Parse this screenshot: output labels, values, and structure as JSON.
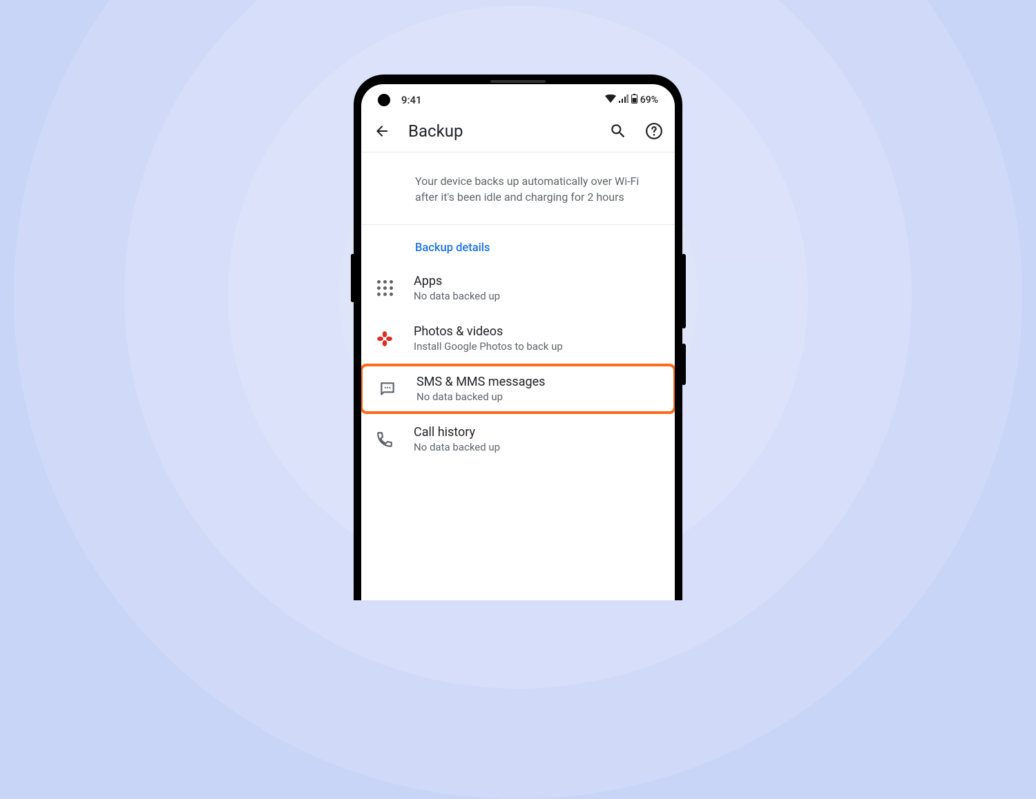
{
  "status": {
    "time": "9:41",
    "battery": "69%"
  },
  "appbar": {
    "title": "Backup"
  },
  "info": "Your device backs up automatically over Wi-Fi after it's been idle and charging for 2 hours",
  "section": {
    "header": "Backup details"
  },
  "items": [
    {
      "title": "Apps",
      "sub": "No data backed up"
    },
    {
      "title": "Photos & videos",
      "sub": "Install Google Photos to back up"
    },
    {
      "title": "SMS & MMS messages",
      "sub": "No data backed up"
    },
    {
      "title": "Call history",
      "sub": "No data backed up"
    }
  ]
}
